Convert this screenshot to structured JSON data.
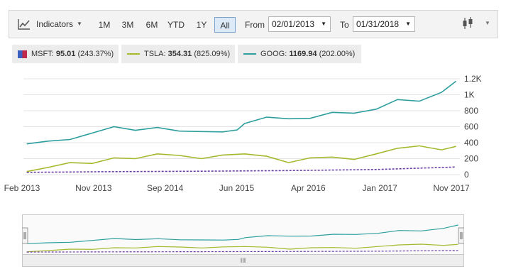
{
  "toolbar": {
    "indicators_label": "Indicators",
    "ranges": [
      "1M",
      "3M",
      "6M",
      "YTD",
      "1Y",
      "All"
    ],
    "active_range": "All",
    "from_label": "From",
    "from_value": "02/01/2013",
    "to_label": "To",
    "to_value": "01/31/2018",
    "chart_type_icon": "candlestick-icon"
  },
  "legend": {
    "msft": {
      "name": "MSFT:",
      "value": "95.01",
      "change": "(243.37%)",
      "color": "#6a3fa5"
    },
    "tsla": {
      "name": "TSLA:",
      "value": "354.31",
      "change": "(825.09%)",
      "color": "#a6b82e"
    },
    "goog": {
      "name": "GOOG:",
      "value": "1169.94",
      "change": "(202.00%)",
      "color": "#2e9e9e"
    }
  },
  "navigator": {
    "handle_label": "III"
  },
  "chart_data": {
    "type": "line",
    "x_tick_labels": [
      "Feb 2013",
      "Nov 2013",
      "Sep 2014",
      "Jun 2015",
      "Apr 2016",
      "Jan 2017",
      "Nov 2017"
    ],
    "y_tick_labels": [
      "0",
      "200",
      "400",
      "600",
      "800",
      "1K",
      "1.2K"
    ],
    "ylim": [
      0,
      1200
    ],
    "xlim": [
      "2013-02-01",
      "2018-01-31"
    ],
    "grid": true,
    "series": [
      {
        "name": "GOOG",
        "color": "#2e9e9e",
        "x": [
          "2013-02",
          "2013-05",
          "2013-08",
          "2013-11",
          "2014-02",
          "2014-05",
          "2014-08",
          "2014-11",
          "2015-02",
          "2015-05",
          "2015-07",
          "2015-08",
          "2015-11",
          "2016-02",
          "2016-05",
          "2016-08",
          "2016-11",
          "2017-02",
          "2017-05",
          "2017-08",
          "2017-11",
          "2018-01"
        ],
        "values": [
          385,
          420,
          440,
          520,
          600,
          555,
          590,
          545,
          540,
          535,
          560,
          640,
          720,
          700,
          705,
          780,
          770,
          820,
          940,
          920,
          1030,
          1170
        ]
      },
      {
        "name": "TSLA",
        "color": "#a6b82e",
        "x": [
          "2013-02",
          "2013-05",
          "2013-08",
          "2013-11",
          "2014-02",
          "2014-05",
          "2014-08",
          "2014-11",
          "2015-02",
          "2015-05",
          "2015-08",
          "2015-11",
          "2016-02",
          "2016-05",
          "2016-08",
          "2016-11",
          "2017-02",
          "2017-05",
          "2017-08",
          "2017-11",
          "2018-01"
        ],
        "values": [
          38,
          90,
          150,
          140,
          210,
          200,
          260,
          240,
          200,
          245,
          260,
          230,
          150,
          210,
          220,
          190,
          260,
          330,
          360,
          310,
          354
        ]
      },
      {
        "name": "MSFT",
        "color": "#6a3fa5",
        "x": [
          "2013-02",
          "2014-02",
          "2015-02",
          "2016-02",
          "2017-02",
          "2018-01"
        ],
        "values": [
          28,
          37,
          43,
          51,
          64,
          95
        ]
      }
    ]
  }
}
